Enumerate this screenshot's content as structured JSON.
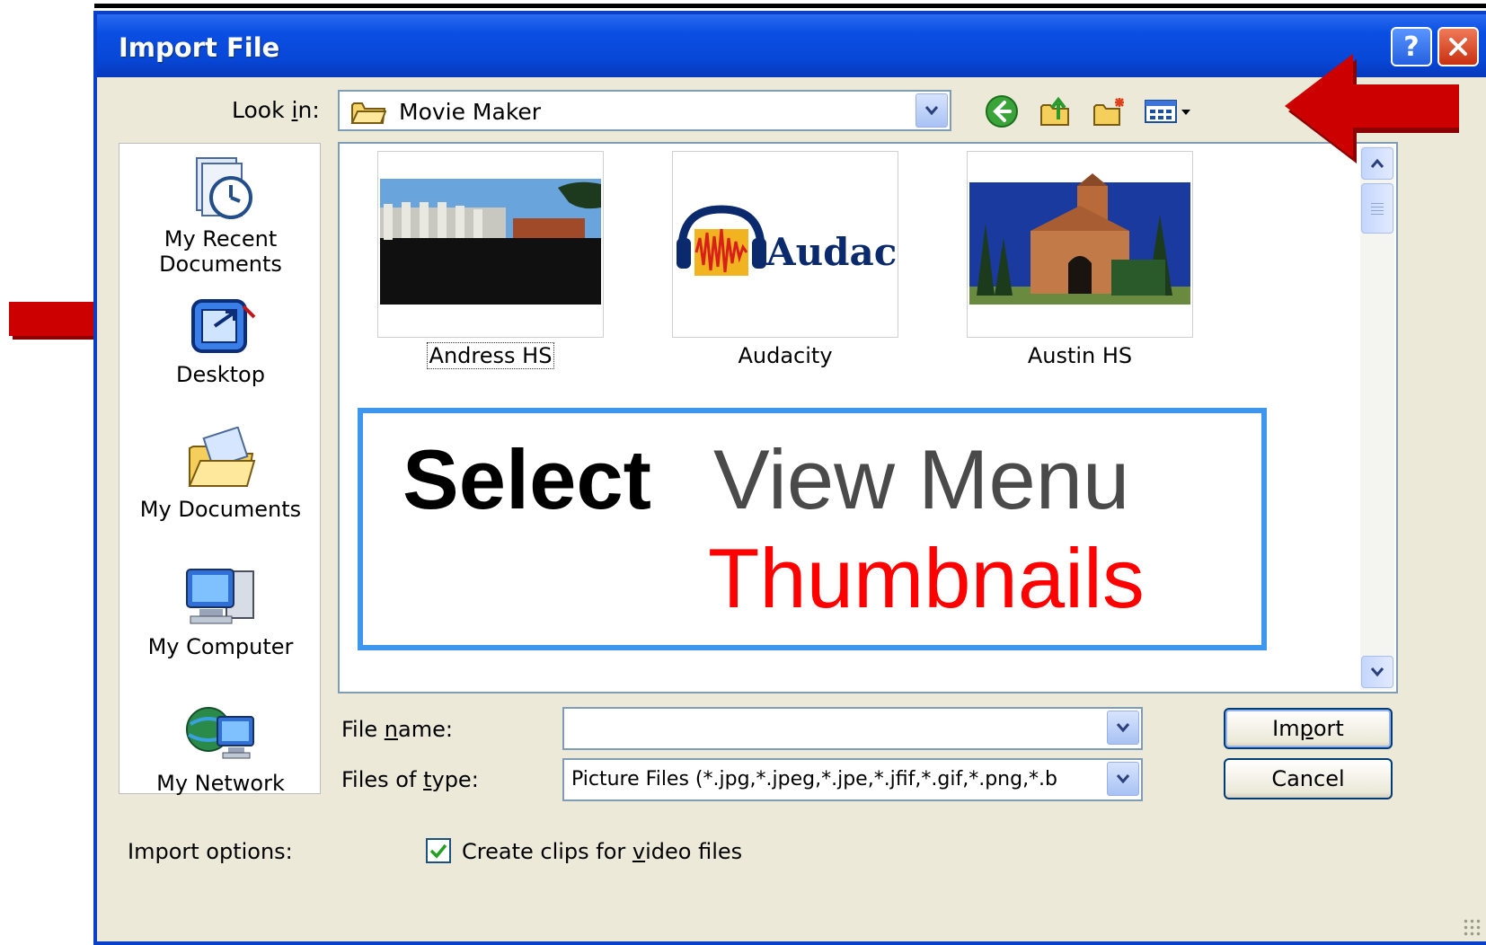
{
  "window": {
    "title": "Import File"
  },
  "look_in": {
    "label_pre": "Look ",
    "label_key": "i",
    "label_post": "n:",
    "value": "Movie Maker"
  },
  "toolbar": {
    "back": "back-icon",
    "up": "up-folder-icon",
    "new_folder": "new-folder-icon",
    "views": "views-menu-icon"
  },
  "places": [
    {
      "line1": "My Recent",
      "line2": "Documents",
      "icon": "recent-documents-icon"
    },
    {
      "line1": "Desktop",
      "line2": "",
      "icon": "desktop-icon"
    },
    {
      "line1": "My Documents",
      "line2": "",
      "icon": "my-documents-icon"
    },
    {
      "line1": "My Computer",
      "line2": "",
      "icon": "my-computer-icon"
    },
    {
      "line1": "My Network",
      "line2": "",
      "icon": "my-network-icon"
    }
  ],
  "files": [
    {
      "name": "Andress HS",
      "selected": true
    },
    {
      "name": "Audacity",
      "selected": false,
      "logo_text": "Audacity"
    },
    {
      "name": "Austin HS",
      "selected": false
    }
  ],
  "callout": {
    "word1": "Select",
    "word2": "View Menu",
    "word3": "Thumbnails"
  },
  "file_name": {
    "label_pre": "File ",
    "label_key": "n",
    "label_post": "ame:",
    "value": ""
  },
  "file_type": {
    "label_pre": "Files of ",
    "label_key": "t",
    "label_post": "ype:",
    "value": "Picture Files (*.jpg,*.jpeg,*.jpe,*.jfif,*.gif,*.png,*.b"
  },
  "buttons": {
    "import_pre": "Im",
    "import_key": "p",
    "import_post": "ort",
    "cancel": "Cancel"
  },
  "import_options": {
    "label": "Import options:",
    "checkbox_pre": "Create clips for ",
    "checkbox_key": "v",
    "checkbox_post": "ideo files",
    "checked": true
  },
  "colors": {
    "titlebar": "#0a4ee2",
    "dialog_bg": "#ece9d8",
    "callout_border": "#3f96ee",
    "arrow_red": "#cc0000",
    "thumbnails_text": "#ff0000"
  }
}
